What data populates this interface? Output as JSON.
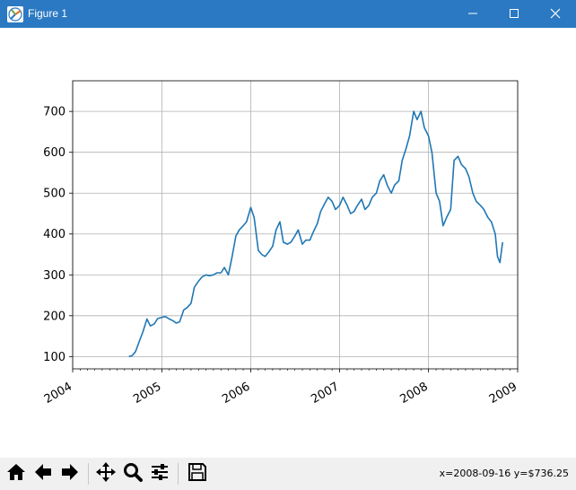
{
  "window": {
    "title": "Figure 1",
    "minimize_icon": "minimize-icon",
    "maximize_icon": "maximize-icon",
    "close_icon": "close-icon"
  },
  "toolbar": {
    "buttons": [
      {
        "name": "home-button",
        "icon": "home-icon"
      },
      {
        "name": "back-button",
        "icon": "arrow-left-icon"
      },
      {
        "name": "forward-button",
        "icon": "arrow-right-icon"
      },
      {
        "name": "pan-button",
        "icon": "move-icon"
      },
      {
        "name": "zoom-button",
        "icon": "magnifier-icon"
      },
      {
        "name": "configure-subplots-button",
        "icon": "sliders-icon"
      },
      {
        "name": "save-button",
        "icon": "floppy-disk-icon"
      }
    ],
    "coords": "x=2008-09-16 y=$736.25"
  },
  "chart_data": {
    "type": "line",
    "title": "",
    "xlabel": "",
    "ylabel": "",
    "xlim": [
      "2004-01-01",
      "2009-01-01"
    ],
    "ylim": [
      70,
      775
    ],
    "x_ticks": [
      "2004",
      "2005",
      "2006",
      "2007",
      "2008",
      "2009"
    ],
    "y_ticks": [
      100,
      200,
      300,
      400,
      500,
      600,
      700
    ],
    "grid": true,
    "line_color": "#1f77b4",
    "series": [
      {
        "x": [
          "2004-08-19",
          "2004-09-01",
          "2004-09-15",
          "2004-10-01",
          "2004-10-15",
          "2004-11-01",
          "2004-11-15",
          "2004-12-01",
          "2004-12-15",
          "2005-01-01",
          "2005-01-15",
          "2005-02-01",
          "2005-02-15",
          "2005-03-01",
          "2005-03-15",
          "2005-04-01",
          "2005-04-15",
          "2005-05-01",
          "2005-05-15",
          "2005-06-01",
          "2005-06-15",
          "2005-07-01",
          "2005-07-15",
          "2005-08-01",
          "2005-08-15",
          "2005-09-01",
          "2005-09-15",
          "2005-10-01",
          "2005-10-15",
          "2005-11-01",
          "2005-11-15",
          "2005-12-01",
          "2005-12-15",
          "2006-01-01",
          "2006-01-15",
          "2006-02-01",
          "2006-02-15",
          "2006-03-01",
          "2006-03-15",
          "2006-04-01",
          "2006-04-15",
          "2006-05-01",
          "2006-05-15",
          "2006-06-01",
          "2006-06-15",
          "2006-07-01",
          "2006-07-15",
          "2006-08-01",
          "2006-08-15",
          "2006-09-01",
          "2006-09-15",
          "2006-10-01",
          "2006-10-15",
          "2006-11-01",
          "2006-11-15",
          "2006-12-01",
          "2006-12-15",
          "2007-01-01",
          "2007-01-15",
          "2007-02-01",
          "2007-02-15",
          "2007-03-01",
          "2007-03-15",
          "2007-04-01",
          "2007-04-15",
          "2007-05-01",
          "2007-05-15",
          "2007-06-01",
          "2007-06-15",
          "2007-07-01",
          "2007-07-15",
          "2007-08-01",
          "2007-08-15",
          "2007-09-01",
          "2007-09-15",
          "2007-10-01",
          "2007-10-15",
          "2007-11-01",
          "2007-11-15",
          "2007-12-01",
          "2007-12-15",
          "2008-01-01",
          "2008-01-15",
          "2008-02-01",
          "2008-02-15",
          "2008-03-01",
          "2008-03-15",
          "2008-04-01",
          "2008-04-15",
          "2008-05-01",
          "2008-05-15",
          "2008-06-01",
          "2008-06-15",
          "2008-07-01",
          "2008-07-15",
          "2008-08-01",
          "2008-08-15",
          "2008-09-01",
          "2008-09-15",
          "2008-10-01",
          "2008-10-10",
          "2008-10-20",
          "2008-10-31"
        ],
        "y": [
          100,
          102,
          112,
          138,
          160,
          192,
          175,
          180,
          193,
          196,
          198,
          192,
          188,
          182,
          185,
          214,
          220,
          230,
          270,
          285,
          295,
          300,
          298,
          300,
          305,
          305,
          318,
          300,
          340,
          395,
          410,
          420,
          430,
          465,
          440,
          360,
          350,
          345,
          355,
          370,
          410,
          430,
          380,
          375,
          380,
          395,
          410,
          375,
          385,
          385,
          405,
          425,
          455,
          475,
          490,
          480,
          460,
          470,
          490,
          470,
          450,
          455,
          470,
          485,
          460,
          470,
          490,
          500,
          530,
          545,
          520,
          500,
          520,
          530,
          580,
          610,
          640,
          700,
          680,
          700,
          660,
          640,
          600,
          500,
          480,
          420,
          440,
          460,
          580,
          590,
          570,
          560,
          540,
          500,
          480,
          470,
          460,
          440,
          430,
          400,
          345,
          330,
          380
        ]
      }
    ]
  }
}
